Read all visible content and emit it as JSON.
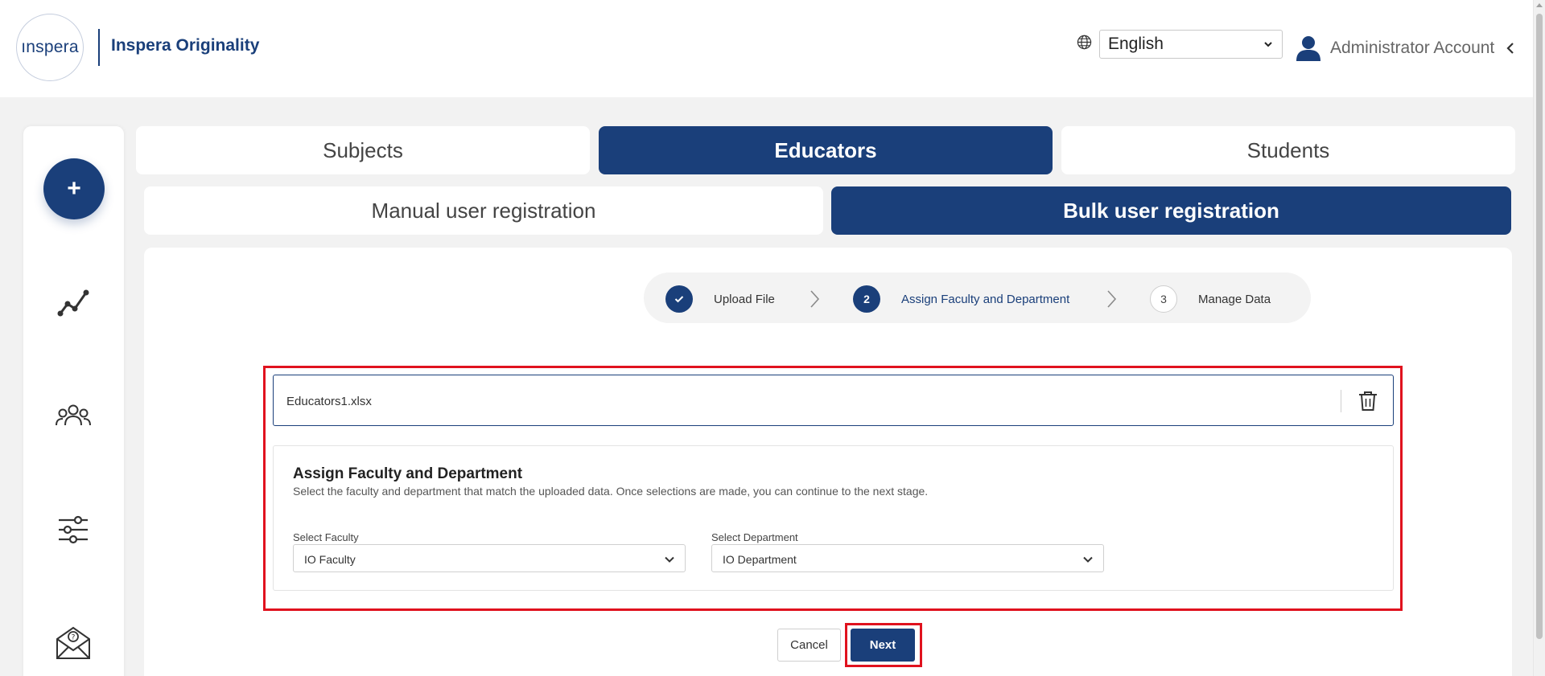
{
  "header": {
    "logo_word": "ınspera",
    "product_name": "Inspera Originality",
    "language": "English",
    "account_name": "Administrator Account"
  },
  "sidenav": {
    "add_label": "+",
    "icons": [
      "analytics-icon",
      "users-group-icon",
      "sliders-icon",
      "help-mail-icon"
    ]
  },
  "tabs": {
    "primary": [
      {
        "label": "Subjects",
        "active": false
      },
      {
        "label": "Educators",
        "active": true
      },
      {
        "label": "Students",
        "active": false
      }
    ],
    "secondary": [
      {
        "label": "Manual user registration",
        "active": false
      },
      {
        "label": "Bulk user registration",
        "active": true
      }
    ]
  },
  "stepper": {
    "steps": [
      {
        "number": "✓",
        "label": "Upload File",
        "state": "done"
      },
      {
        "number": "2",
        "label": "Assign Faculty and Department",
        "state": "current"
      },
      {
        "number": "3",
        "label": "Manage Data",
        "state": "todo"
      }
    ]
  },
  "upload": {
    "file_name": "Educators1.xlsx"
  },
  "assign": {
    "title": "Assign Faculty and Department",
    "description": "Select the faculty and department that match the uploaded data. Once selections are made, you can continue to the next stage.",
    "faculty_label": "Select Faculty",
    "faculty_value": "IO Faculty",
    "department_label": "Select Department",
    "department_value": "IO Department"
  },
  "actions": {
    "cancel_label": "Cancel",
    "next_label": "Next"
  },
  "colors": {
    "brand": "#1a3f7a",
    "highlight": "#e0121e"
  }
}
